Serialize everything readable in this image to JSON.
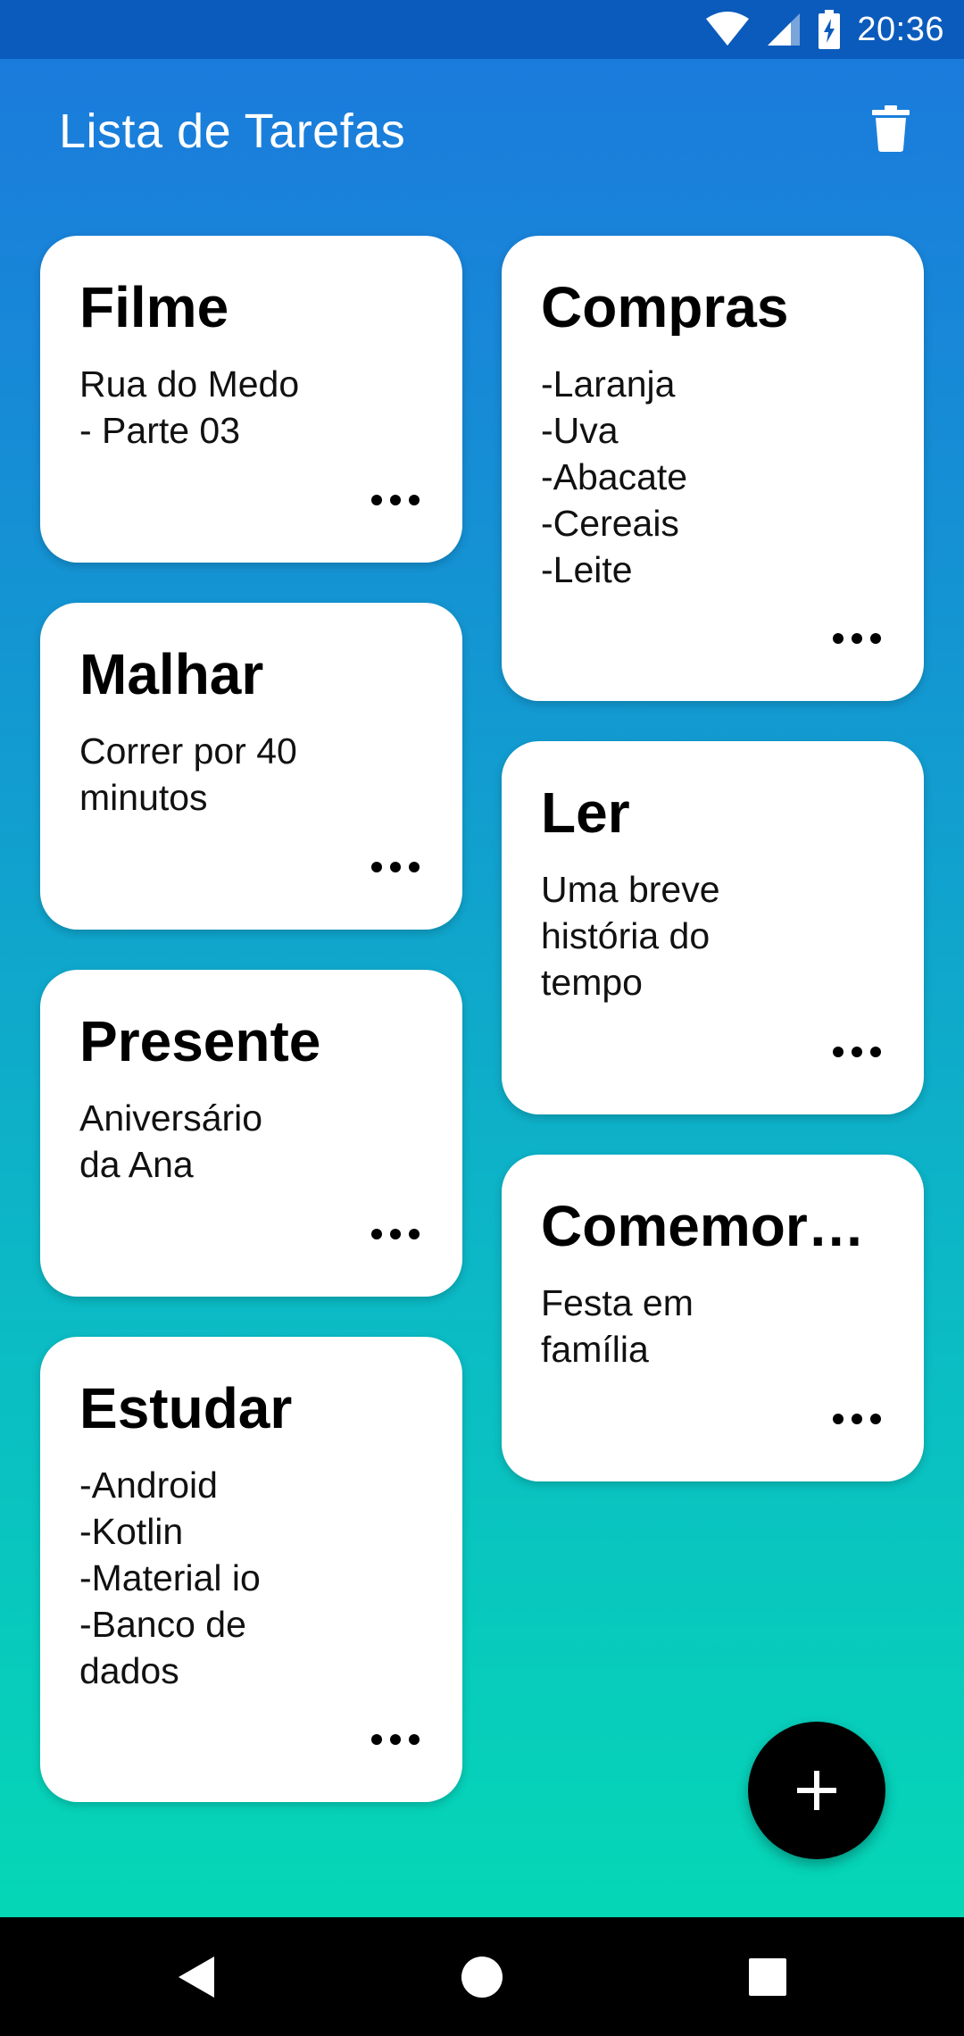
{
  "status_bar": {
    "time": "20:36"
  },
  "app_bar": {
    "title": "Lista de Tarefas",
    "delete_icon": "trash-icon"
  },
  "left_column": [
    {
      "title": "Filme",
      "body": "Rua do Medo\n- Parte 03"
    },
    {
      "title": "Malhar",
      "body": "Correr por 40\nminutos"
    },
    {
      "title": "Presente",
      "body": "Aniversário\nda Ana"
    },
    {
      "title": "Estudar",
      "body": "-Android\n-Kotlin\n-Material io\n-Banco de\ndados"
    }
  ],
  "right_column": [
    {
      "title": "Compras",
      "body": "-Laranja\n-Uva\n-Abacate\n-Cereais\n-Leite"
    },
    {
      "title": "Ler",
      "body": "Uma breve\nhistória do\ntempo"
    },
    {
      "title": "Comemoração",
      "body": "Festa em\nfamília"
    }
  ],
  "fab": {
    "icon": "plus-icon"
  },
  "nav_bar": {
    "back_icon": "back-triangle-icon",
    "home_icon": "home-circle-icon",
    "recents_icon": "recents-square-icon"
  },
  "colors": {
    "gradient_top": "#1c78dd",
    "gradient_bottom": "#05d7b6",
    "status_bar": "#0b5bbd",
    "card": "#ffffff",
    "fab": "#000000"
  }
}
